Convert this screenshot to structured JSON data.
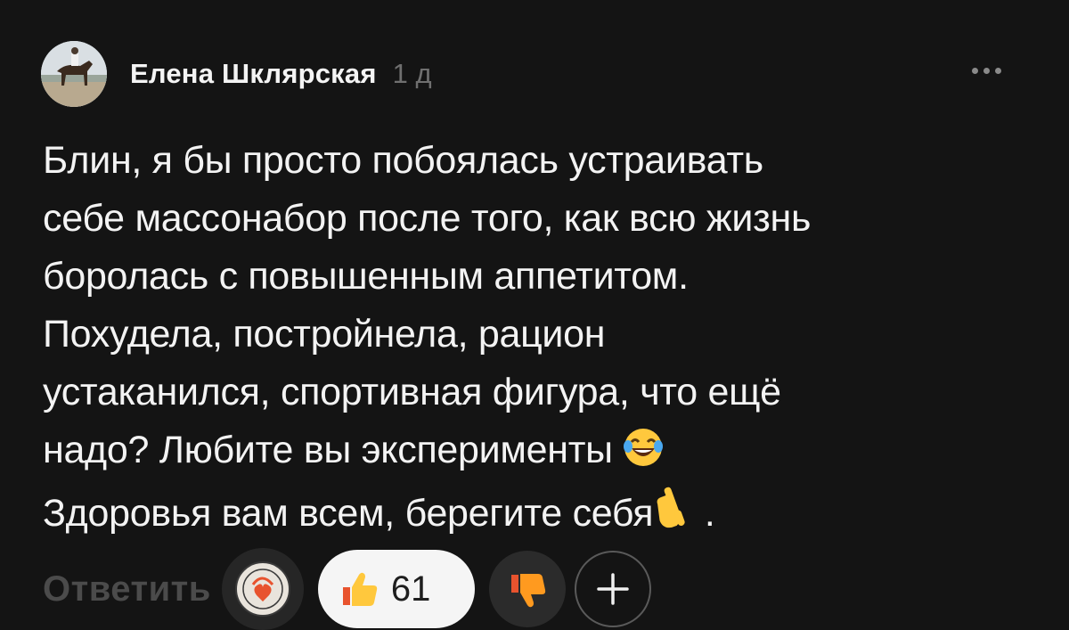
{
  "comment": {
    "author": "Елена Шклярская",
    "time": "1 д",
    "text_lines": [
      "Блин, я бы просто побоялась устраивать",
      "себе массонабор после того, как всю жизнь",
      "боролась с повышенным аппетитом.",
      "Похудела, постройнела, рацион",
      "устаканился, спортивная фигура, что ещё",
      "надо? Любите вы эксперименты",
      "Здоровья вам всем, берегите себя",
      " ."
    ],
    "emojis": [
      "laughing-crying-emoji",
      "pointing-down-emoji"
    ]
  },
  "actions": {
    "reply_label": "Ответить",
    "like_count": "61"
  },
  "icons": {
    "more": "more-dots-icon",
    "like": "thumbs-up-icon",
    "dislike": "thumbs-down-icon",
    "add": "plus-icon"
  },
  "colors": {
    "background": "#141414",
    "text": "#f3f3f3",
    "muted": "#6f6f6f",
    "reply": "#4b4b4b",
    "like_pill": "#f5f5f5",
    "emoji_yellow": "#ffc83d",
    "dislike_orange": "#ff9a1f"
  }
}
